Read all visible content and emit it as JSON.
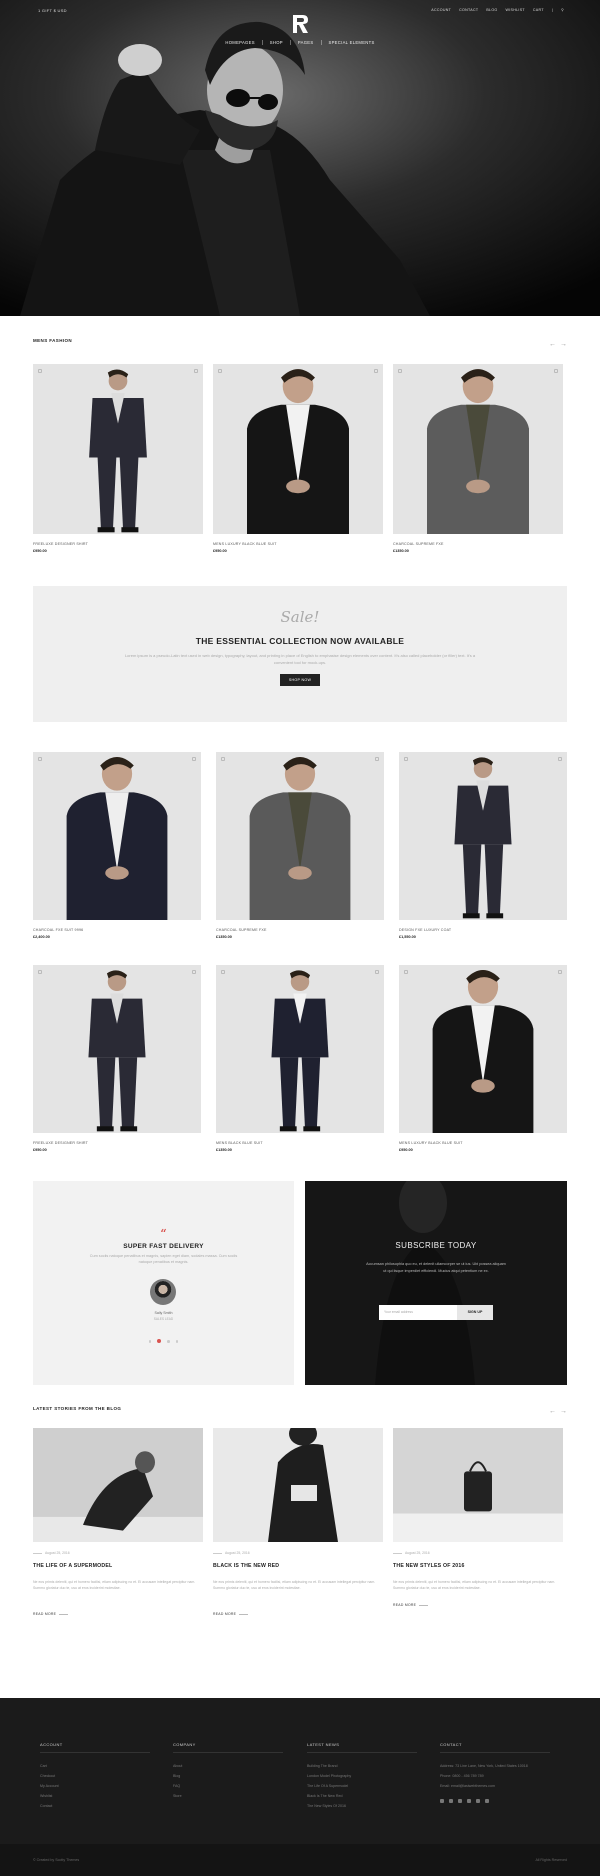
{
  "header": {
    "top_left": "1 GIFT   $ USD",
    "top_nav": [
      "ACCOUNT",
      "CONTACT",
      "BLOG",
      "WISHLIST",
      "CART"
    ],
    "main_nav": [
      "HOMEPAGES",
      "SHOP",
      "PAGES",
      "SPECIAL ELEMENTS"
    ]
  },
  "mens_fashion": {
    "title": "MENS FASHION",
    "products": [
      {
        "name": "FREELUXE DESIGNER SHIRT",
        "price": "£950.00"
      },
      {
        "name": "MENS LUXURY BLACK BLUE SUIT",
        "price": "£950.00"
      },
      {
        "name": "CHARCOAL SUPREME FXE",
        "price": "£1350.00"
      }
    ]
  },
  "sale": {
    "script": "Sale!",
    "headline": "THE ESSENTIAL COLLECTION NOW AVAILABLE",
    "description": "Lorem ipsum is a pseudo-Latin text used in web design, typography, layout, and printing in place of English to emphasise design elements over content. It's also called placeholder (or filler) text. It's a convenient tool for mock-ups.",
    "button": "SHOP NOW"
  },
  "grid_products": [
    {
      "name": "CHARCOAL FXE SUIT 9996",
      "price": "£2,400.00"
    },
    {
      "name": "CHARCOAL SUPREME FXE",
      "price": "£1350.00"
    },
    {
      "name": "DESIGN FXE LUXURY COAT",
      "price": "£1,550.00"
    },
    {
      "name": "FREELUXE DESIGNER SHIRT",
      "price": "£950.00"
    },
    {
      "name": "MENS BLACK BLUE SUIT",
      "price": "£1350.00"
    },
    {
      "name": "MENS LUXURY BLACK BLUE SUIT",
      "price": "£950.00"
    }
  ],
  "delivery": {
    "quote": "“",
    "title": "SUPER FAST DELIVERY",
    "text": "Cum sociis natoque penatibus et magnis, sapien eget diam, sodales massa. Cum sociis natoque penatibus et magnis.",
    "person": "Sally Smith",
    "role": "SALES LEAD"
  },
  "subscribe": {
    "title": "SUBSCRIBE TODAY",
    "text": "Accumsan philosophia quo eu, et delenit ullamcorper se ut ius. Ubi possea aliquam ut qui iisque imperdiet efficiendi. Mucius atqui petentium ne ex.",
    "placeholder": "Your email address",
    "button": "SIGN UP"
  },
  "blog": {
    "title": "LATEST STORIES FROM THE BLOG",
    "posts": [
      {
        "date": "August 25, 2016",
        "title": "THE LIFE OF A SUPERMODEL",
        "excerpt": "Ne eos primis deleniti, qui et homero facilisi, etiam adipiscing no et. Ei accusam intellegat percipitur nam. Summo gloriatur duo te, usu at eros inciderint molestiae.",
        "more": "READ MORE"
      },
      {
        "date": "August 25, 2016",
        "title": "BLACK IS THE NEW RED",
        "excerpt": "Ne eos primis deleniti, qui et homero facilisi, etiam adipiscing no et. Ei accusam intellegat percipitur nam. Summo gloriatur duo te, usu at eros inciderint molestiae.",
        "more": "READ MORE"
      },
      {
        "date": "August 25, 2016",
        "title": "THE NEW STYLES OF 2016",
        "excerpt": "Ne eos primis deleniti, qui et homero facilisi, etiam adipiscing no et. Ei accusam intellegat percipitur nam. Summo gloriatur duo te, usu at eros inciderint molestiae.",
        "more": "READ MORE"
      }
    ]
  },
  "footer": {
    "account": {
      "title": "ACCOUNT",
      "items": [
        "Cart",
        "Checkout",
        "My Account",
        "Wishlist",
        "Contact"
      ]
    },
    "company": {
      "title": "COMPANY",
      "items": [
        "About",
        "Blog",
        "FAQ",
        "Store"
      ]
    },
    "news": {
      "title": "LATEST NEWS",
      "items": [
        "Building The Brand",
        "London Model Photography",
        "The Life Of A Supermodel",
        "Black Is The New Red",
        "The New Styles Of 2016"
      ]
    },
    "contact": {
      "title": "CONTACT",
      "items": [
        "Address: 73 Line Lane, New York, United States 10018",
        "Phone: 0800 - 456 789 789",
        "Email: email@lastwebthemes.com"
      ]
    },
    "copyright": "© Created by Scotty Themes",
    "rights": "All Rights Reserved"
  }
}
